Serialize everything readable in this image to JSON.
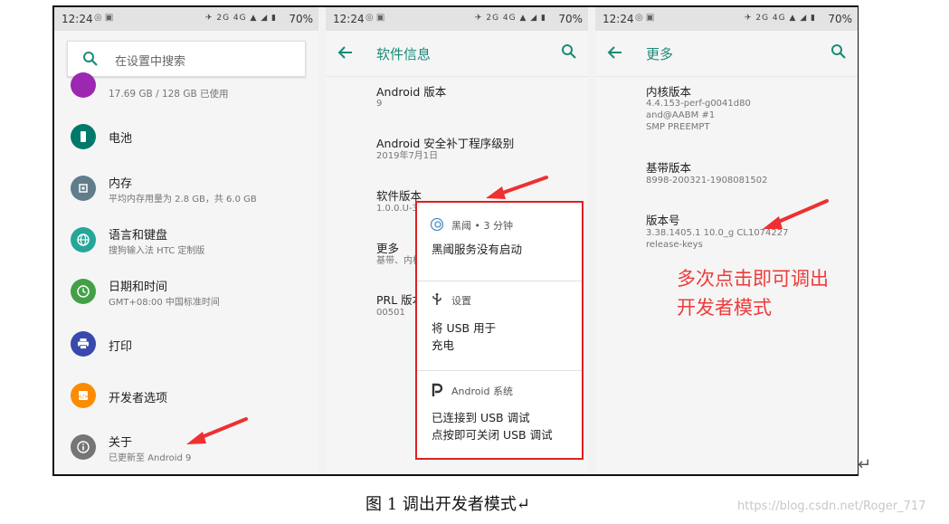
{
  "status_bar": {
    "time": "12:24",
    "battery": "70%",
    "signal": "2G 4G"
  },
  "panel1": {
    "search_placeholder": "在设置中搜索",
    "items": [
      {
        "title": "",
        "subtitle": "17.69 GB / 128 GB 已使用",
        "icon": "storage-icon",
        "color": "#9c27b0"
      },
      {
        "title": "电池",
        "subtitle": "",
        "icon": "battery-icon",
        "color": "#00796b"
      },
      {
        "title": "内存",
        "subtitle": "平均内存用量为 2.8 GB，共 6.0 GB",
        "icon": "memory-icon",
        "color": "#607d8b"
      },
      {
        "title": "语言和键盘",
        "subtitle": "搜狗输入法 HTC 定制版",
        "icon": "globe-icon",
        "color": "#26a69a"
      },
      {
        "title": "日期和时间",
        "subtitle": "GMT+08:00 中国标准时间",
        "icon": "clock-icon",
        "color": "#43a047"
      },
      {
        "title": "打印",
        "subtitle": "",
        "icon": "print-icon",
        "color": "#3949ab"
      },
      {
        "title": "开发者选项",
        "subtitle": "",
        "icon": "code-icon",
        "color": "#fb8c00"
      },
      {
        "title": "关于",
        "subtitle": "已更新至 Android 9",
        "icon": "info-icon",
        "color": "#757575"
      }
    ]
  },
  "panel2": {
    "title": "软件信息",
    "items": [
      {
        "title": "Android 版本",
        "subtitle": "9"
      },
      {
        "title": "Android 安全补丁程序级别",
        "subtitle": "2019年7月1日"
      },
      {
        "title": "软件版本",
        "subtitle": "1.0.0.U-3w"
      },
      {
        "title": "更多",
        "subtitle": "基带、内核版本等"
      },
      {
        "title": "PRL 版本",
        "subtitle": "00501"
      }
    ]
  },
  "panel3": {
    "title": "更多",
    "items": [
      {
        "title": "内核版本",
        "subtitle": [
          "4.4.153-perf-g0041d80",
          "and@AABM #1",
          "SMP PREEMPT"
        ]
      },
      {
        "title": "基带版本",
        "subtitle": [
          "8998-200321-1908081502"
        ]
      },
      {
        "title": "版本号",
        "subtitle": [
          "3.38.1405.1 10.0_g CL1074227",
          "release-keys"
        ]
      }
    ]
  },
  "notifications": [
    {
      "header": "黑阈 • 3 分钟",
      "body": [
        "黑阈服务没有启动"
      ],
      "icon": "heiyu-icon"
    },
    {
      "header": "设置",
      "body": [
        "将 USB 用于",
        "充电"
      ],
      "icon": "usb-icon"
    },
    {
      "header": "Android 系统",
      "body": [
        "已连接到 USB 调试",
        "点按即可关闭 USB 调试"
      ],
      "icon": "android-p-icon"
    }
  ],
  "annotation": {
    "line1": "多次点击即可调出",
    "line2": "开发者模式",
    "color": "#ee3b3b"
  },
  "caption": "图 1  调出开发者模式↵",
  "watermark": "https://blog.csdn.net/Roger_717",
  "return_mark": "↵",
  "accent_color": "#1a8b78"
}
